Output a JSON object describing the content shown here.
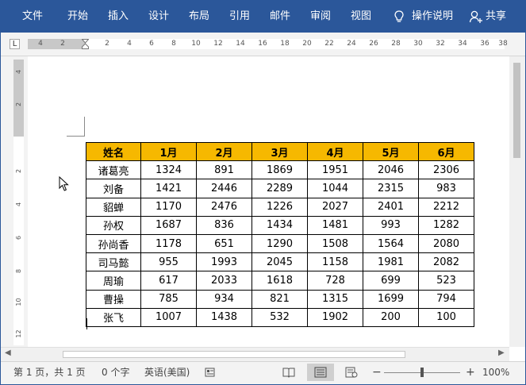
{
  "ribbon": {
    "tabs": [
      "文件",
      "开始",
      "插入",
      "设计",
      "布局",
      "引用",
      "邮件",
      "审阅",
      "视图"
    ],
    "tell_me": "操作说明",
    "share": "共享",
    "lightbulb_icon": "lightbulb-icon",
    "share_icon": "person-add-icon"
  },
  "ruler": {
    "corner_label": "L",
    "horizontal_numbers": [
      "4",
      "2",
      "2",
      "4",
      "6",
      "8",
      "10",
      "12",
      "14",
      "16",
      "18",
      "20",
      "22",
      "24",
      "26",
      "28",
      "30",
      "32",
      "34",
      "36",
      "38"
    ],
    "vertical_numbers": [
      "4",
      "2",
      "2",
      "4",
      "6",
      "8",
      "10",
      "12"
    ]
  },
  "table": {
    "headers": [
      "姓名",
      "1月",
      "2月",
      "3月",
      "4月",
      "5月",
      "6月"
    ],
    "rows": [
      [
        "诸葛亮",
        "1324",
        "891",
        "1869",
        "1951",
        "2046",
        "2306"
      ],
      [
        "刘备",
        "1421",
        "2446",
        "2289",
        "1044",
        "2315",
        "983"
      ],
      [
        "貂蝉",
        "1170",
        "2476",
        "1226",
        "2027",
        "2401",
        "2212"
      ],
      [
        "孙权",
        "1687",
        "836",
        "1434",
        "1481",
        "993",
        "1282"
      ],
      [
        "孙尚香",
        "1178",
        "651",
        "1290",
        "1508",
        "1564",
        "2080"
      ],
      [
        "司马懿",
        "955",
        "1993",
        "2045",
        "1158",
        "1981",
        "2082"
      ],
      [
        "周瑜",
        "617",
        "2033",
        "1618",
        "728",
        "699",
        "523"
      ],
      [
        "曹操",
        "785",
        "934",
        "821",
        "1315",
        "1699",
        "794"
      ],
      [
        "张飞",
        "1007",
        "1438",
        "532",
        "1902",
        "200",
        "100"
      ]
    ],
    "header_color": "#f6b800"
  },
  "status_bar": {
    "page_info": "第 1 页，共 1 页",
    "word_count": "0 个字",
    "language": "英语(美国)",
    "zoom_minus": "−",
    "zoom_plus": "+",
    "zoom": "100%",
    "zoom_fraction": 0.5
  },
  "colors": {
    "ribbon": "#2b579a"
  }
}
